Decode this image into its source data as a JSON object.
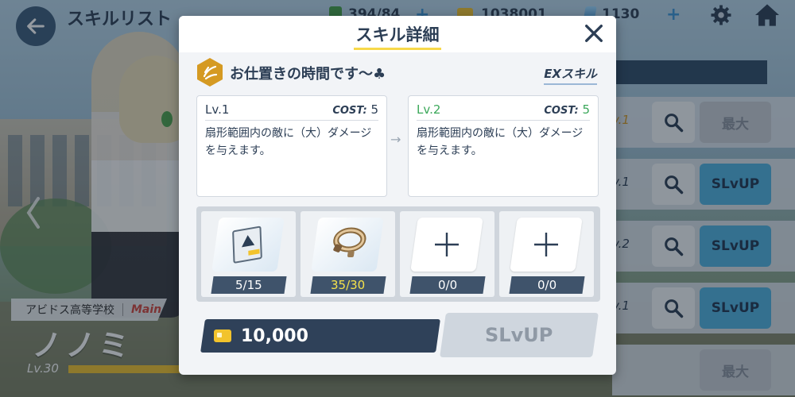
{
  "header": {
    "title": "スキルリスト",
    "ap": "394/84",
    "credits": "1038001",
    "gems": "1130"
  },
  "character": {
    "school": "アビドス高等学校",
    "role": "Main",
    "name": "ノノミ",
    "level": "Lv.30"
  },
  "skill_list": {
    "rows": [
      {
        "lv": "v.1",
        "action": "最大"
      },
      {
        "lv": "v.1",
        "action": "SLvUP"
      },
      {
        "lv": "v.2",
        "action": "SLvUP"
      },
      {
        "lv": "v.1",
        "action": "SLvUP"
      },
      {
        "lv": "",
        "action": "最大"
      }
    ]
  },
  "modal": {
    "title": "スキル詳細",
    "skill_name": "お仕置きの時間です～♣",
    "skill_type": "EXスキル",
    "current": {
      "level": "Lv.1",
      "cost_label": "COST:",
      "cost": "5",
      "description": "扇形範囲内の敵に（大）ダメージを与えます。"
    },
    "next": {
      "level": "Lv.2",
      "cost_label": "COST:",
      "cost": "5",
      "description": "扇形範囲内の敵に（大）ダメージを与えます。"
    },
    "materials": [
      {
        "name": "blueray-icon",
        "count": "5/15"
      },
      {
        "name": "artifact-icon",
        "count": "35/30"
      },
      {
        "name": "empty-slot",
        "count": "0/0"
      },
      {
        "name": "empty-slot",
        "count": "0/0"
      }
    ],
    "credit_cost": "10,000",
    "upgrade_label": "SLvUP"
  },
  "colors": {
    "navy": "#2c3e55",
    "accent_yellow": "#f7d84a",
    "level_green": "#3ba85a",
    "enough_yellow": "#f6e24a",
    "button_blue": "#4fb3e0"
  }
}
